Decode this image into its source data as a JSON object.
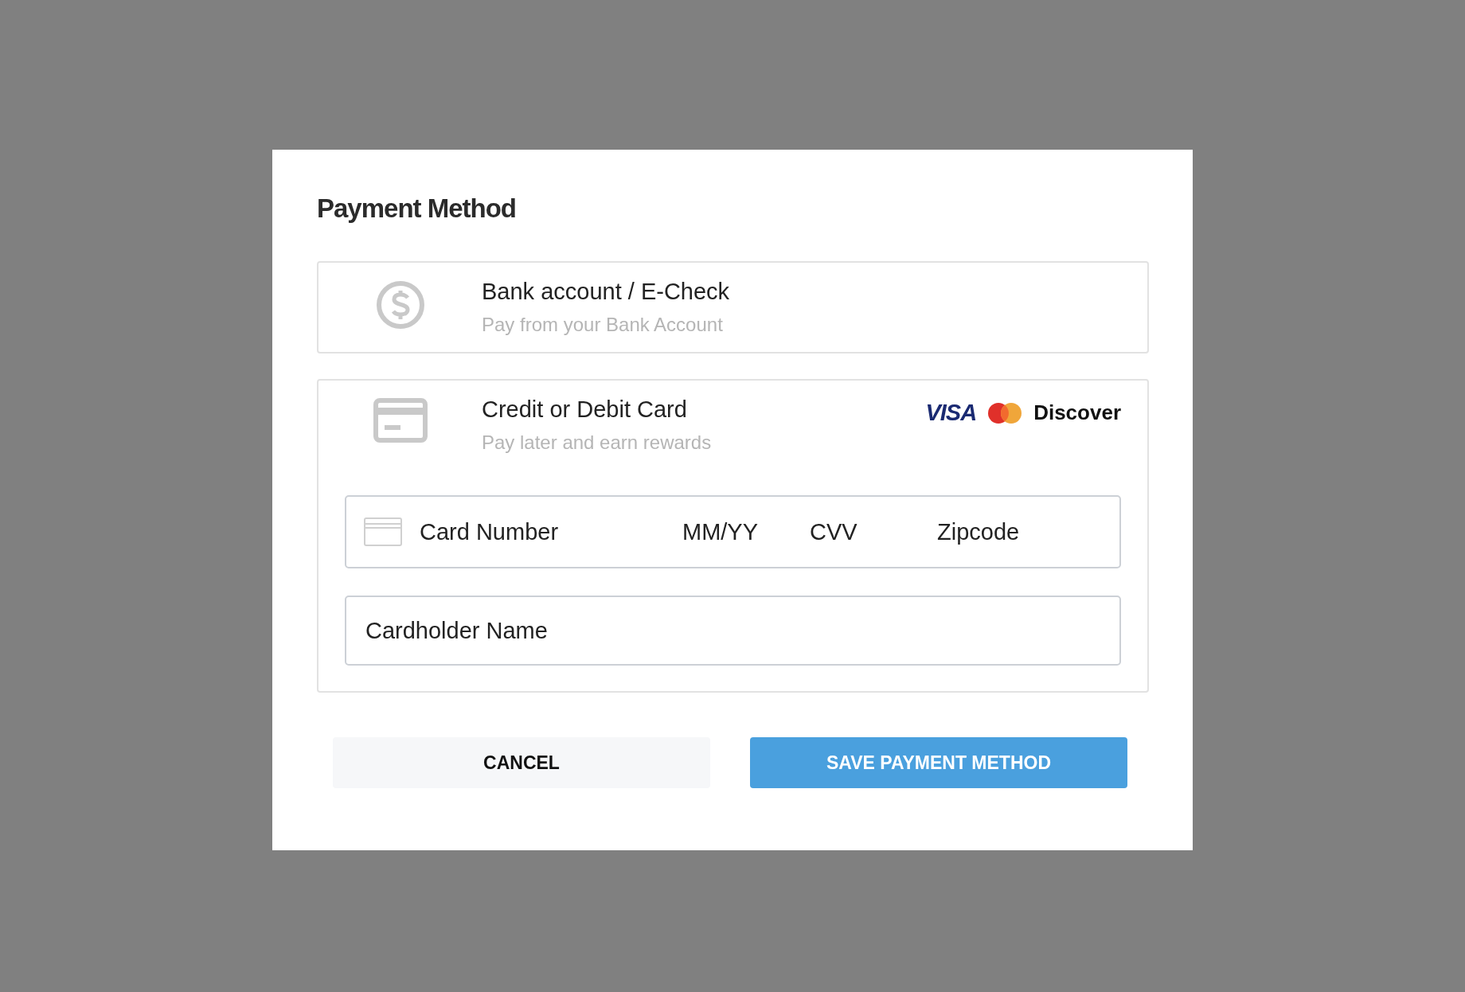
{
  "dialog": {
    "title": "Payment Method",
    "options": [
      {
        "kind": "bank",
        "title": "Bank account / E-Check",
        "subtitle": "Pay from your Bank Account"
      },
      {
        "kind": "card",
        "title": "Credit or Debit Card",
        "subtitle": "Pay later and earn rewards",
        "brands": [
          {
            "kind": "visa",
            "label": "VISA"
          },
          {
            "kind": "mastercard"
          },
          {
            "kind": "discover",
            "label": "Discover"
          }
        ],
        "fields": [
          {
            "kind": "card_number",
            "placeholder": "Card Number"
          },
          {
            "kind": "expiry",
            "placeholder": "MM/YY"
          },
          {
            "kind": "cvv",
            "placeholder": "CVV"
          },
          {
            "kind": "zip",
            "placeholder": "Zipcode"
          }
        ],
        "name_field": {
          "placeholder": "Cardholder Name"
        }
      }
    ],
    "buttons": [
      {
        "kind": "secondary",
        "label": "CANCEL"
      },
      {
        "kind": "primary",
        "label": "SAVE PAYMENT METHOD"
      }
    ]
  }
}
